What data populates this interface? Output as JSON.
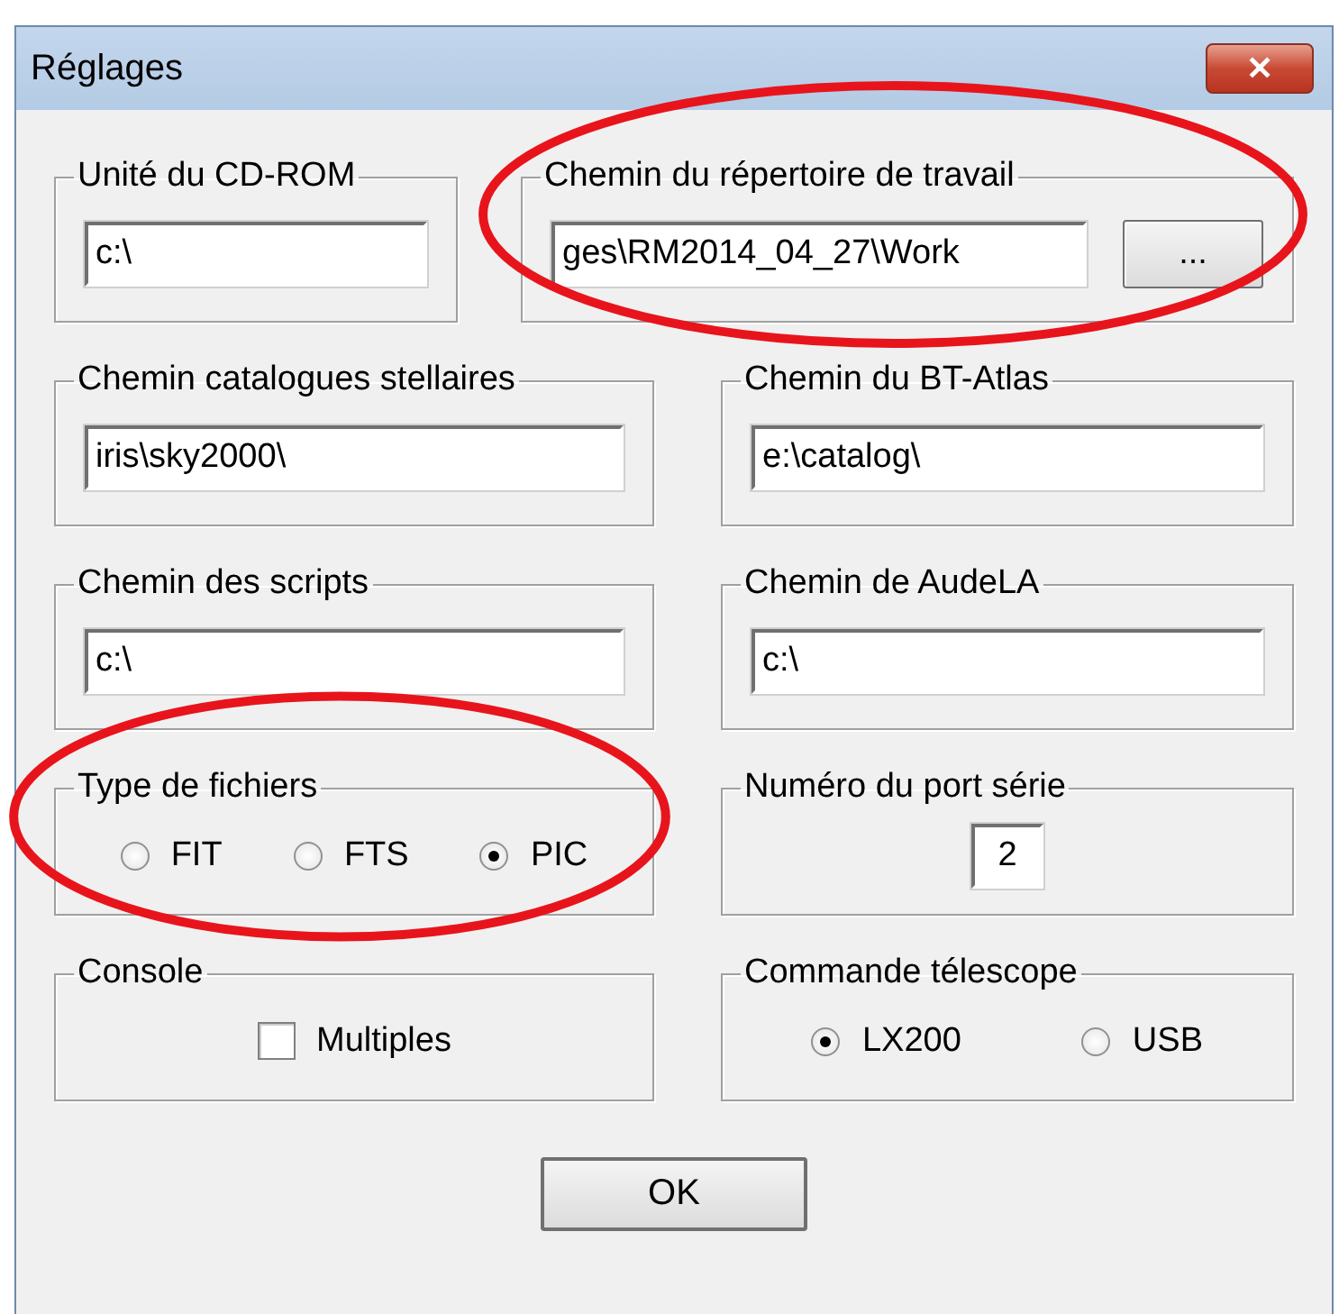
{
  "window": {
    "title": "Réglages",
    "close_button": "✕"
  },
  "rows": [
    [
      {
        "label": "Unité du CD-ROM",
        "kind": "field",
        "value": "c:\\",
        "highlight": false
      },
      {
        "label": "Chemin du répertoire de travail",
        "kind": "field",
        "value": "ges\\RM2014_04_27\\Work",
        "browse": "...",
        "highlight": true
      }
    ],
    [
      {
        "label": "Chemin catalogues stellaires",
        "kind": "field",
        "value": "iris\\sky2000\\",
        "highlight": false
      },
      {
        "label": "Chemin du BT-Atlas",
        "kind": "field",
        "value": "e:\\catalog\\",
        "highlight": false
      }
    ],
    [
      {
        "label": "Chemin des scripts",
        "kind": "field",
        "value": "c:\\",
        "highlight": false
      },
      {
        "label": "Chemin de AudeLA",
        "kind": "field",
        "value": "c:\\",
        "highlight": false
      }
    ],
    [
      {
        "label": "Type de fichiers",
        "kind": "radios",
        "options": [
          {
            "label": "FIT",
            "selected": false
          },
          {
            "label": "FTS",
            "selected": false
          },
          {
            "label": "PIC",
            "selected": true
          }
        ],
        "highlight": true
      },
      {
        "label": "Numéro du port série",
        "kind": "number",
        "value": "2",
        "highlight": false
      }
    ],
    [
      {
        "label": "Console",
        "kind": "checkbox",
        "text": "Multiples",
        "checked": false,
        "highlight": false
      },
      {
        "label": "Commande télescope",
        "kind": "radios",
        "options": [
          {
            "label": "LX200",
            "selected": true
          },
          {
            "label": "USB",
            "selected": false
          }
        ],
        "highlight": false
      }
    ]
  ],
  "ok_button": "OK"
}
